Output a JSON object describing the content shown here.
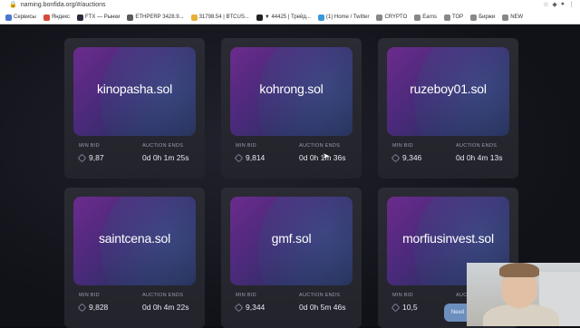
{
  "browser": {
    "url": "naming.bonfida.org/#/auctions",
    "bookmarks": [
      {
        "label": "Сервисы",
        "color": "#4a78d0"
      },
      {
        "label": "Яндекс",
        "color": "#d64a3a"
      },
      {
        "label": "FTX — Рынки",
        "color": "#2b2b3a"
      },
      {
        "label": "ETHPERP 3428.9...",
        "color": "#5a5a5a"
      },
      {
        "label": "31798.54 | BTCUS...",
        "color": "#e6b13a"
      },
      {
        "label": "▼ 44425 | Трейд...",
        "color": "#222222"
      },
      {
        "label": "(1) Home / Twitter",
        "color": "#3a9ad9"
      },
      {
        "label": "CRYPTO",
        "color": "#888888"
      },
      {
        "label": "Earns",
        "color": "#888888"
      },
      {
        "label": "TOP",
        "color": "#888888"
      },
      {
        "label": "Биржи",
        "color": "#888888"
      },
      {
        "label": "NEW",
        "color": "#888888"
      }
    ]
  },
  "labels": {
    "min_bid": "MIN BID",
    "auction_ends": "AUCTION ENDS"
  },
  "auctions": [
    {
      "name": "kinopasha.sol",
      "min_bid": "9,87",
      "ends": "0d 0h 1m 25s"
    },
    {
      "name": "kohrong.sol",
      "min_bid": "9,814",
      "ends": "0d 0h 1m 36s"
    },
    {
      "name": "ruzeboy01.sol",
      "min_bid": "9,346",
      "ends": "0d 0h 4m 13s"
    },
    {
      "name": "saintcena.sol",
      "min_bid": "9,828",
      "ends": "0d 0h 4m 22s"
    },
    {
      "name": "gmf.sol",
      "min_bid": "9,344",
      "ends": "0d 0h 5m 46s"
    },
    {
      "name": "morfiusinvest.sol",
      "min_bid": "10,5",
      "ends": ""
    }
  ],
  "help_button": "Need",
  "icons": {
    "bid_currency": "solana-icon",
    "lock": "lock-icon"
  }
}
